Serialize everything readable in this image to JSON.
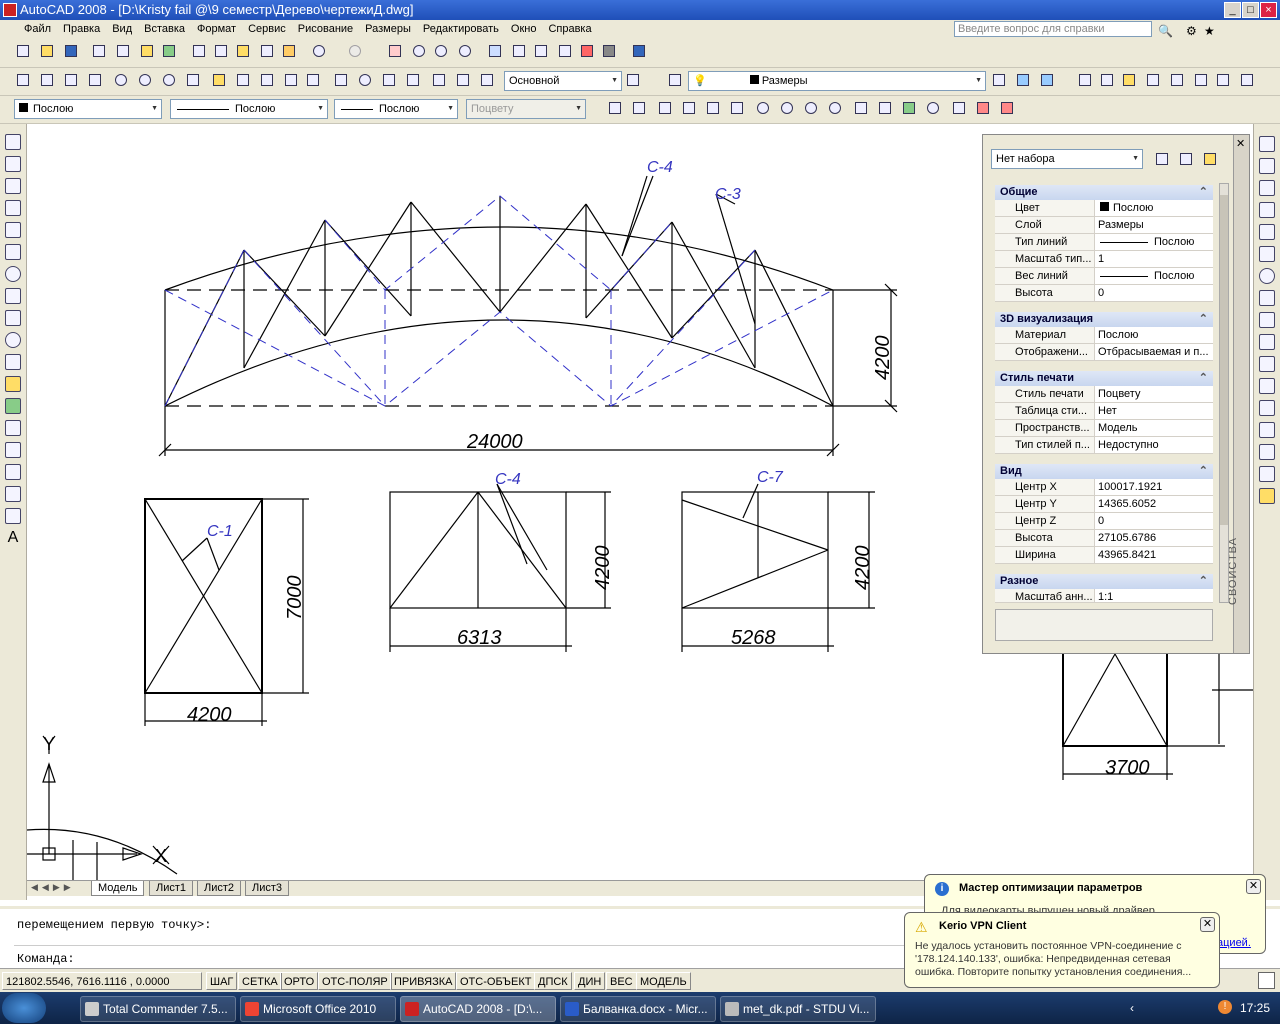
{
  "window": {
    "title": "AutoCAD 2008 - [D:\\Kristy fail @\\9 семестр\\Дерево\\чертежиД.dwg]"
  },
  "menu": {
    "items": [
      "Файл",
      "Правка",
      "Вид",
      "Вставка",
      "Формат",
      "Сервис",
      "Рисование",
      "Размеры",
      "Редактировать",
      "Окно",
      "Справка"
    ],
    "help_placeholder": "Введите вопрос для справки"
  },
  "toolbar": {
    "text_style": "Основной",
    "layer": "Размеры",
    "color": "Послою",
    "linetype": "Послою",
    "lineweight": "Послою",
    "plotstyle": "Поцвету"
  },
  "drawing": {
    "labels": {
      "c4_top": "С-4",
      "c3": "С-3",
      "c1": "С-1",
      "c4_mid": "С-4",
      "c7": "С-7"
    },
    "dims": {
      "main_height": "4200",
      "main_span": "24000",
      "p1_height": "7000",
      "p1_width": "4200",
      "p2_height": "4200",
      "p2_width": "6313",
      "p3_height": "4200",
      "p3_width": "5268",
      "p4_width": "3700"
    },
    "ucs": {
      "x": "X",
      "y": "Y"
    }
  },
  "tabs": [
    "Модель",
    "Лист1",
    "Лист2",
    "Лист3"
  ],
  "properties": {
    "selection": "Нет набора",
    "side_title": "СВОЙСТВА",
    "groups": [
      {
        "title": "Общие",
        "rows": [
          [
            "Цвет",
            "Послою"
          ],
          [
            "Слой",
            "Размеры"
          ],
          [
            "Тип линий",
            "Послою"
          ],
          [
            "Масштаб тип...",
            "1"
          ],
          [
            "Вес линий",
            "Послою"
          ],
          [
            "Высота",
            "0"
          ]
        ]
      },
      {
        "title": "3D визуализация",
        "rows": [
          [
            "Материал",
            "Послою"
          ],
          [
            "Отображени...",
            "Отбрасываемая и п..."
          ]
        ]
      },
      {
        "title": "Стиль печати",
        "rows": [
          [
            "Стиль печати",
            "Поцвету"
          ],
          [
            "Таблица сти...",
            "Нет"
          ],
          [
            "Пространств...",
            "Модель"
          ],
          [
            "Тип стилей п...",
            "Недоступно"
          ]
        ]
      },
      {
        "title": "Вид",
        "rows": [
          [
            "Центр X",
            "100017.1921"
          ],
          [
            "Центр Y",
            "14365.6052"
          ],
          [
            "Центр Z",
            "0"
          ],
          [
            "Высота",
            "27105.6786"
          ],
          [
            "Ширина",
            "43965.8421"
          ]
        ]
      },
      {
        "title": "Разное",
        "rows": [
          [
            "Масштаб анн...",
            "1:1"
          ]
        ]
      }
    ]
  },
  "command": {
    "line1": "перемещением первую точку>:",
    "line2": "Команда:"
  },
  "status": {
    "coords": "121802.5546, 7616.1116 , 0.0000",
    "buttons": [
      "ШАГ",
      "СЕТКА",
      "ОРТО",
      "ОТС-ПОЛЯР",
      "ПРИВЯЗКА",
      "ОТС-ОБЪЕКТ",
      "ДПСК",
      "ДИН",
      "ВЕС",
      "МОДЕЛЬ"
    ]
  },
  "notifications": {
    "wizard": {
      "title": "Мастер оптимизации параметров",
      "text": "Для видеокарты выпущен новый драйвер",
      "link": "ацией."
    },
    "vpn": {
      "title": "Kerio VPN Client",
      "text": "Не удалось установить постоянное VPN-соединение с '178.124.140.133', ошибка: Непредвиденная сетевая ошибка. Повторите попытку установления соединения..."
    }
  },
  "taskbar": {
    "items": [
      "Total Commander 7.5...",
      "Microsoft Office 2010",
      "AutoCAD 2008 - [D:\\...",
      "Балванка.docx - Micr...",
      "met_dk.pdf - STDU Vi..."
    ],
    "clock": "17:25"
  },
  "colors": {
    "title_bar": "#2a5cc8",
    "blue_dash": "#3030c8",
    "label_blue": "#3535c0"
  }
}
